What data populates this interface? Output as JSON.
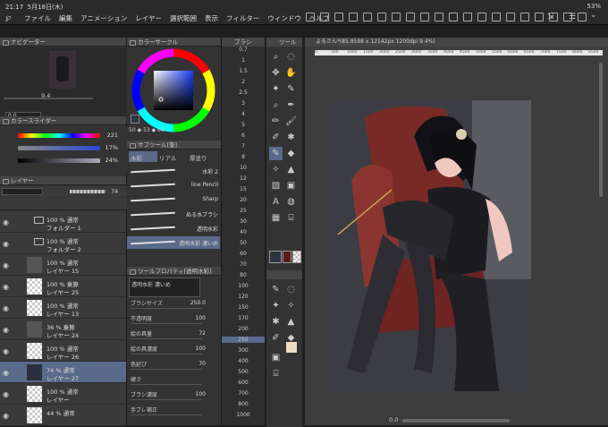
{
  "status": {
    "time": "21:17",
    "date": "5月18日(木)",
    "battery": "53%"
  },
  "menu": [
    "ファイル",
    "編集",
    "アニメーション",
    "レイヤー",
    "選択範囲",
    "表示",
    "フィルター",
    "ウィンドウ",
    "ヘルプ"
  ],
  "panels": {
    "navigator": "ナビゲーター",
    "color_circle": "カラーサークル",
    "brush_size": "ブラシ",
    "tool": "ツール",
    "color_slider": "カラースライダー",
    "subtool": "サブツール[筆]",
    "layer": "レイヤー",
    "tool_property": "ツールプロパティ[透明水彩]",
    "canvas_tab": "よるさん*(85.8598 x 12142px 1200dpi 9.4%)"
  },
  "navigator": {
    "zoom": "9.4",
    "angle": "0.0"
  },
  "hsv": {
    "h": "221",
    "s": "17%",
    "v": "24%",
    "labels": [
      "H",
      "S",
      "V"
    ]
  },
  "color_values": {
    "a": "50",
    "b": "53",
    "c": "60"
  },
  "layer_opacity": "74",
  "layers": [
    {
      "l1": "100 % 通常",
      "l2": "フォルダー 1",
      "type": "folder"
    },
    {
      "l1": "100 % 通常",
      "l2": "フォルダー 2",
      "type": "folder"
    },
    {
      "l1": "100 % 通常",
      "l2": "レイヤー 15",
      "type": "layer"
    },
    {
      "l1": "100 % 乗算",
      "l2": "レイヤー 25",
      "type": "layer"
    },
    {
      "l1": "100 % 通常",
      "l2": "レイヤー 13",
      "type": "layer"
    },
    {
      "l1": "36 % 乗算",
      "l2": "レイヤー 24",
      "type": "layer"
    },
    {
      "l1": "100 % 通常",
      "l2": "レイヤー 26",
      "type": "layer"
    },
    {
      "l1": "74 % 通常",
      "l2": "レイヤー 27",
      "type": "layer",
      "selected": true
    },
    {
      "l1": "100 % 通常",
      "l2": "レイヤー",
      "type": "layer"
    },
    {
      "l1": "44 % 通常",
      "l2": "",
      "type": "layer"
    }
  ],
  "subtool_tabs": [
    "水彩",
    "リアル",
    "厚塗り"
  ],
  "brushes": [
    "水彩 2",
    "line Pencil",
    "Sharp",
    "ぬる水ブラシ",
    "透明水彩",
    "透明水彩 濃いめ"
  ],
  "brush_selected": "透明水彩 濃いめ",
  "properties": [
    {
      "label": "ブラシサイズ",
      "value": "250.0"
    },
    {
      "label": "不透明度",
      "value": "100"
    },
    {
      "label": "絵の具量",
      "value": "72"
    },
    {
      "label": "絵の具濃度",
      "value": "100"
    },
    {
      "label": "色延び",
      "value": "70"
    },
    {
      "label": "硬さ",
      "value": ""
    },
    {
      "label": "ブラシ濃度",
      "value": "100"
    },
    {
      "label": "手ブレ補正",
      "value": ""
    }
  ],
  "property_preset": "透明水彩 濃いめ",
  "brush_sizes_left": [
    "0.7",
    "1",
    "1.5",
    "2",
    "2.5",
    "3",
    "4",
    "5",
    "6",
    "7",
    "8",
    "10",
    "12",
    "15",
    "20",
    "25",
    "30",
    "40",
    "50",
    "60",
    "70",
    "80",
    "100",
    "120",
    "150",
    "170",
    "200",
    "250",
    "300",
    "400",
    "500",
    "600",
    "700",
    "800",
    "1000"
  ],
  "brush_size_selected": "250",
  "ruler_ticks": [
    "0",
    "500",
    "1000",
    "1500",
    "2000",
    "2500",
    "3000",
    "3500",
    "4000",
    "4500",
    "5000",
    "5500",
    "6000",
    "6500",
    "7000",
    "7500",
    "8000",
    "8500"
  ],
  "bottom_values": {
    "zoom": "0.0"
  },
  "colors": {
    "accent": "#5a6a8a",
    "selected_layer": "#5a6a8a"
  }
}
